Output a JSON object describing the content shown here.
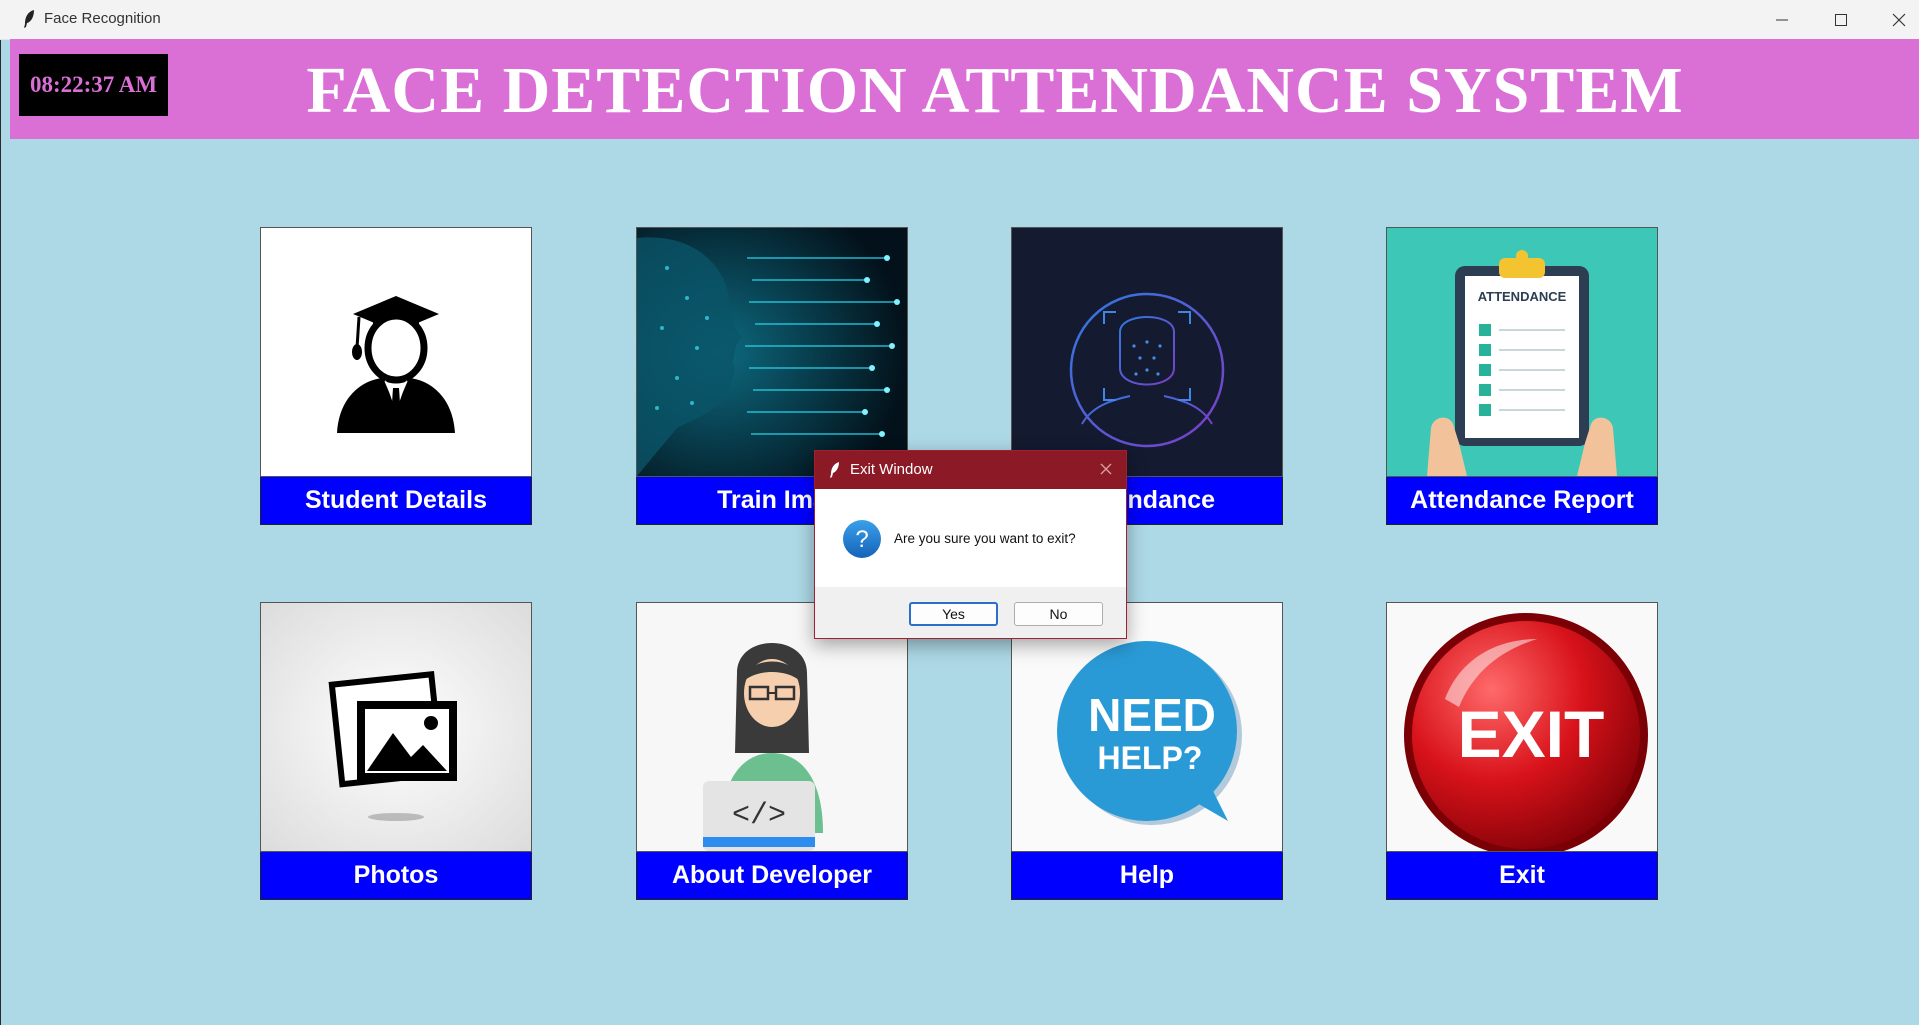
{
  "window": {
    "title": "Face Recognition"
  },
  "header": {
    "clock": "08:22:37 AM",
    "title": "FACE DETECTION ATTENDANCE SYSTEM",
    "bg_color": "#da70d6"
  },
  "cards": [
    {
      "label": "Student Details",
      "icon": "graduate-icon"
    },
    {
      "label": "Train Ima",
      "icon": "ai-circuit-head-image"
    },
    {
      "label": "Attendance",
      "icon": "face-scan-icon"
    },
    {
      "label": "Attendance Report",
      "icon": "attendance-clipboard-image",
      "clipboard_title": "ATTENDANCE"
    },
    {
      "label": "Photos",
      "icon": "photos-icon"
    },
    {
      "label": "About Developer",
      "icon": "developer-image",
      "code_text": "</>"
    },
    {
      "label": "Help",
      "icon": "need-help-bubble",
      "bubble_line1": "NEED",
      "bubble_line2": "HELP?"
    },
    {
      "label": "Exit",
      "icon": "exit-button-image",
      "exit_text": "EXIT"
    }
  ],
  "dialog": {
    "title": "Exit Window",
    "message": "Are you sure you want to exit?",
    "yes_label": "Yes",
    "no_label": "No"
  },
  "colors": {
    "background": "#add8e6",
    "button": "#0000ff",
    "dialog_title": "#8b1a26"
  }
}
